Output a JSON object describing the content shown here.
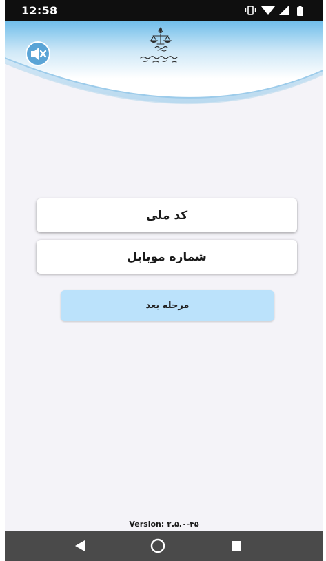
{
  "status_bar": {
    "time": "12:58",
    "icons": [
      "vibrate-icon",
      "wifi-icon",
      "signal-icon",
      "battery-icon"
    ]
  },
  "header": {
    "sound_button_icon": "sound-muted-icon",
    "logo_icon": "judiciary-emblem-icon"
  },
  "form": {
    "national_code_placeholder": "کد ملی",
    "mobile_placeholder": "شماره موبایل",
    "next_button_label": "مرحله بعد"
  },
  "footer": {
    "version_text": "Version: ۲.۵.۰-۴۵"
  },
  "nav_bar": {
    "icons": [
      "back-icon",
      "home-icon",
      "recents-icon"
    ]
  },
  "colors": {
    "header_gradient_top": "#6fbdea",
    "header_gradient_bottom": "#ffffff",
    "page_background": "#f4f3f8",
    "next_button": "#bbe2fb",
    "nav_bar": "#4a4a4a",
    "status_bar": "#0f0f0f"
  }
}
